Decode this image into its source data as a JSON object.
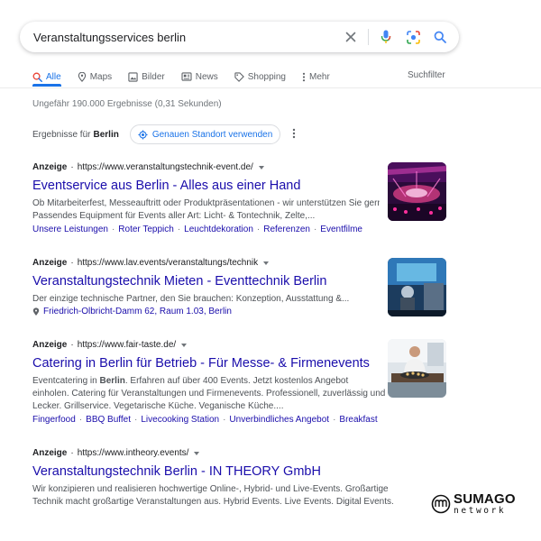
{
  "search": {
    "query": "Veranstaltungsservices berlin"
  },
  "icons": {
    "clear": "close-icon",
    "voice": "microphone-icon",
    "lens": "camera-icon",
    "search": "search-icon"
  },
  "tabs": [
    {
      "label": "Alle",
      "icon": "search-icon",
      "active": true
    },
    {
      "label": "Maps",
      "icon": "map-pin-icon"
    },
    {
      "label": "Bilder",
      "icon": "image-icon"
    },
    {
      "label": "News",
      "icon": "news-icon"
    },
    {
      "label": "Shopping",
      "icon": "tag-icon"
    },
    {
      "label": "Mehr",
      "icon": "more-dots-icon"
    }
  ],
  "search_filter_label": "Suchfilter",
  "stats": "Ungefähr 190.000 Ergebnisse (0,31 Sekunden)",
  "location": {
    "prefix": "Ergebnisse für",
    "city": "Berlin",
    "chip_label": "Genauen Standort verwenden"
  },
  "results": [
    {
      "ad_label": "Anzeige",
      "url": "https://www.veranstaltungstechnik-event.de/",
      "title": "Eventservice aus Berlin - Alles aus einer Hand",
      "desc_line1": "Ob Mitarbeiterfest, Messeauftritt oder Produktpräsentationen - wir unterstützen Sie gern!",
      "desc_line2": "Passendes Equipment für Events aller Art: Licht- & Tontechnik, Zelte,...",
      "links": [
        "Unsere Leistungen",
        "Roter Teppich",
        "Leuchtdekoration",
        "Referenzen",
        "Eventfilme"
      ]
    },
    {
      "ad_label": "Anzeige",
      "url": "https://www.lav.events/veranstaltungs/technik",
      "title": "Veranstaltungstechnik Mieten - Eventtechnik Berlin",
      "desc_line1": "Der einzige technische Partner, den Sie brauchen: Konzeption, Ausstattung &...",
      "address": "Friedrich-Olbricht-Damm 62, Raum 1.03, Berlin"
    },
    {
      "ad_label": "Anzeige",
      "url": "https://www.fair-taste.de/",
      "title": "Catering in Berlin für Betrieb - Für Messe- & Firmenevents",
      "desc_line1_pre": "Eventcatering in ",
      "desc_line1_bold": "Berlin",
      "desc_line1_post": ". Erfahren auf über 400 Events. Jetzt kostenlos Angebot",
      "desc_line2": "einholen. Catering für Veranstaltungen und Firmenevents. Professionell, zuverlässig und",
      "desc_line3": "Lecker. Grillservice. Vegetarische Küche. Veganische Küche....",
      "links": [
        "Fingerfood",
        "BBQ Buffet",
        "Livecooking Station",
        "Unverbindliches Angebot",
        "Breakfast"
      ]
    },
    {
      "ad_label": "Anzeige",
      "url": "https://www.intheory.events/",
      "title": "Veranstaltungstechnik Berlin - IN THEORY GmbH",
      "desc_line1": "Wir konzipieren und realisieren hochwertige Online-, Hybrid- und Live-Events. Großartige",
      "desc_line2": "Technik macht großartige Veranstaltungen aus. Hybrid Events. Live Events. Digital Events."
    }
  ],
  "separator": "·",
  "watermark": {
    "main": "SUMAGO",
    "sub": "network"
  },
  "colors": {
    "link_title": "#1a0dab",
    "accent": "#1a73e8",
    "text_secondary": "#4d5156"
  }
}
